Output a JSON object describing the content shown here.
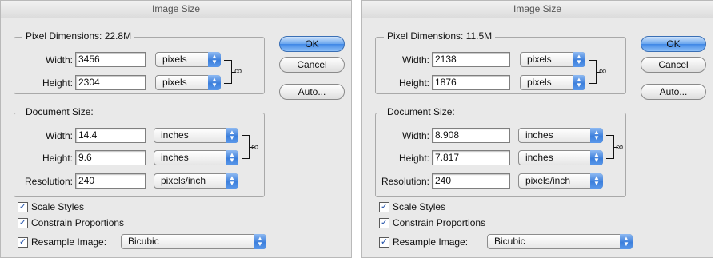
{
  "dialogs": [
    {
      "title": "Image Size",
      "pixel_dimensions": {
        "title_label": "Pixel Dimensions:",
        "value": "22.8M",
        "width": {
          "label": "Width:",
          "value": "3456",
          "unit": "pixels"
        },
        "height": {
          "label": "Height:",
          "value": "2304",
          "unit": "pixels"
        }
      },
      "document_size": {
        "title_label": "Document Size:",
        "width": {
          "label": "Width:",
          "value": "14.4",
          "unit": "inches"
        },
        "height": {
          "label": "Height:",
          "value": "9.6",
          "unit": "inches"
        },
        "resolution": {
          "label": "Resolution:",
          "value": "240",
          "unit": "pixels/inch"
        }
      },
      "buttons": {
        "ok": "OK",
        "cancel": "Cancel",
        "auto": "Auto..."
      },
      "checkboxes": {
        "scale_styles": {
          "label": "Scale Styles",
          "checked": true
        },
        "constrain": {
          "label": "Constrain Proportions",
          "checked": true
        },
        "resample": {
          "label": "Resample Image:",
          "checked": true,
          "method": "Bicubic"
        }
      }
    },
    {
      "title": "Image Size",
      "pixel_dimensions": {
        "title_label": "Pixel Dimensions:",
        "value": "11.5M",
        "width": {
          "label": "Width:",
          "value": "2138",
          "unit": "pixels"
        },
        "height": {
          "label": "Height:",
          "value": "1876",
          "unit": "pixels"
        }
      },
      "document_size": {
        "title_label": "Document Size:",
        "width": {
          "label": "Width:",
          "value": "8.908",
          "unit": "inches"
        },
        "height": {
          "label": "Height:",
          "value": "7.817",
          "unit": "inches"
        },
        "resolution": {
          "label": "Resolution:",
          "value": "240",
          "unit": "pixels/inch"
        }
      },
      "buttons": {
        "ok": "OK",
        "cancel": "Cancel",
        "auto": "Auto..."
      },
      "checkboxes": {
        "scale_styles": {
          "label": "Scale Styles",
          "checked": true
        },
        "constrain": {
          "label": "Constrain Proportions",
          "checked": true
        },
        "resample": {
          "label": "Resample Image:",
          "checked": true,
          "method": "Bicubic"
        }
      }
    }
  ],
  "icons": {
    "link": "chain-link-icon",
    "checkmark": "checkmark-icon",
    "popup_arrows": "up-down-arrows-icon"
  }
}
